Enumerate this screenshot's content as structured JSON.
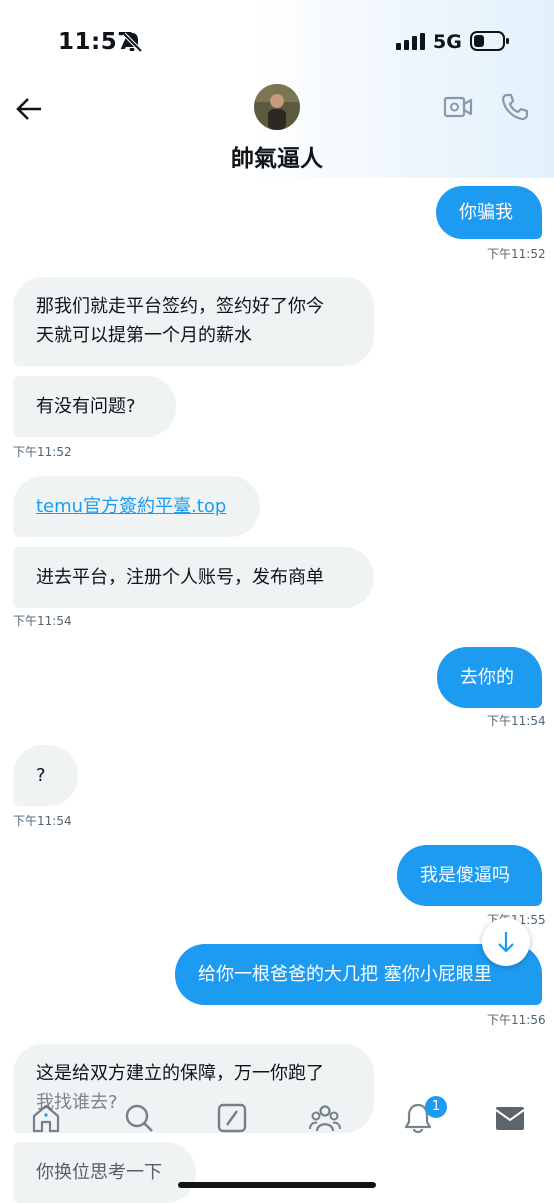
{
  "status_bar": {
    "time": "11:57",
    "network": "5G"
  },
  "header": {
    "contact_name": "帥氣逼人"
  },
  "messages": [
    {
      "text": "你骗我",
      "time": "下午11:52"
    },
    {
      "text": "那我们就走平台签约，签约好了你今",
      "text2": "天就可以提第一个月的薪水"
    },
    {
      "text": "有没有问题?",
      "time": "下午11:52"
    },
    {
      "text": "temu官方簽約平臺.top"
    },
    {
      "text": "进去平台，注册个人账号，发布商单",
      "time": "下午11:54"
    },
    {
      "text": "去你的",
      "time": "下午11:54"
    },
    {
      "text": "?",
      "time": "下午11:54"
    },
    {
      "text": "我是傻逼吗",
      "time": "下午11:55"
    },
    {
      "text": "给你一根爸爸的大几把 塞你小屁眼里",
      "time": "下午11:56"
    },
    {
      "text": "这是给双方建立的保障，万一你跑了",
      "text2": "我找谁去?"
    },
    {
      "text": "你换位思考一下"
    }
  ],
  "tabbar": {
    "notification_count": "1"
  },
  "colors": {
    "accent": "#1d9bf0",
    "incoming_bubble": "#eff3f4",
    "text": "#0f1419",
    "timestamp": "#536471"
  }
}
